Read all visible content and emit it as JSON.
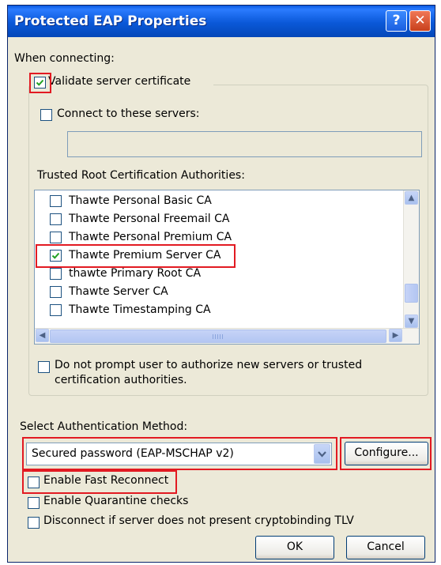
{
  "window": {
    "title": "Protected EAP Properties",
    "help_glyph": "?",
    "close_glyph": "✕"
  },
  "connecting": {
    "heading": "When connecting:",
    "validate_label": "Validate server certificate",
    "validate_checked": true,
    "connect_servers_label": "Connect to these servers:",
    "connect_servers_checked": false,
    "servers_value": ""
  },
  "trusted": {
    "heading": "Trusted Root Certification Authorities:",
    "items": [
      {
        "label": "Thawte Personal Basic CA",
        "checked": false
      },
      {
        "label": "Thawte Personal Freemail CA",
        "checked": false
      },
      {
        "label": "Thawte Personal Premium CA",
        "checked": false
      },
      {
        "label": "Thawte Premium Server CA",
        "checked": true
      },
      {
        "label": "thawte Primary Root CA",
        "checked": false
      },
      {
        "label": "Thawte Server CA",
        "checked": false
      },
      {
        "label": "Thawte Timestamping CA",
        "checked": false
      }
    ]
  },
  "prompt": {
    "line1": "Do not prompt user to authorize new servers or trusted",
    "line2": "certification authorities.",
    "checked": false
  },
  "auth": {
    "heading": "Select Authentication Method:",
    "selected": "Secured password (EAP-MSCHAP v2)",
    "configure_label": "Configure..."
  },
  "options": {
    "fast_reconnect": "Enable Fast Reconnect",
    "quarantine": "Enable Quarantine checks",
    "cryptobinding": "Disconnect if server does not present cryptobinding TLV"
  },
  "buttons": {
    "ok": "OK",
    "cancel": "Cancel"
  },
  "colors": {
    "title_bar": "#0a58d8",
    "highlight": "#e21a22",
    "dialog_bg": "#ece9d8"
  }
}
